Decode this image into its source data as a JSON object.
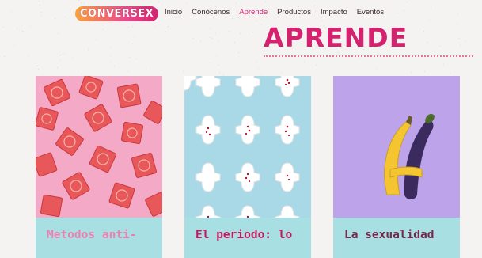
{
  "brand": {
    "logo_text": "CONVERSEX"
  },
  "nav": {
    "items": [
      {
        "label": "Inicio"
      },
      {
        "label": "Conócenos"
      },
      {
        "label": "Aprende",
        "active": true
      },
      {
        "label": "Productos"
      },
      {
        "label": "Impacto"
      },
      {
        "label": "Eventos"
      }
    ]
  },
  "page": {
    "title": "APRENDE"
  },
  "cards": [
    {
      "caption": "Metodos anti-",
      "image": "condoms-photo",
      "image_bg": "#f4a9c6"
    },
    {
      "caption": "El periodo: lo",
      "image": "sanitary-pads-photo",
      "image_bg": "#a9d9e6"
    },
    {
      "caption": "La sexualidad",
      "image": "banana-eggplant-photo",
      "image_bg": "#bca3ea"
    }
  ],
  "colors": {
    "accent": "#d4226f",
    "caption_bg": "#a8dfe2",
    "background": "#f4f3f1"
  }
}
